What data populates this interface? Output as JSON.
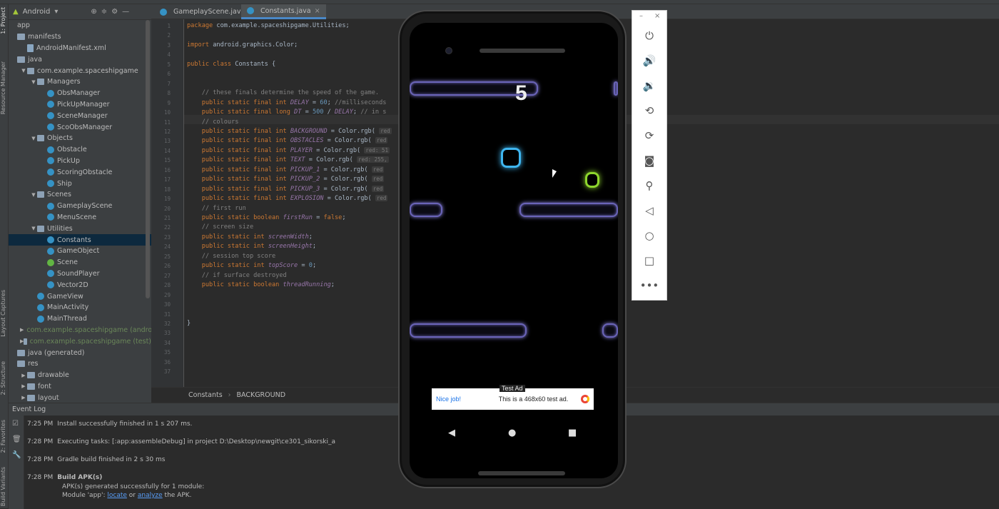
{
  "project_panel": {
    "view_selector": "Android",
    "tree": [
      {
        "label": "app",
        "depth": 0,
        "icon": "none",
        "arrow": ""
      },
      {
        "label": "manifests",
        "depth": 0,
        "icon": "folder",
        "arrow": ""
      },
      {
        "label": "AndroidManifest.xml",
        "depth": 1,
        "icon": "xml",
        "arrow": ""
      },
      {
        "label": "java",
        "depth": 0,
        "icon": "folder",
        "arrow": ""
      },
      {
        "label": "com.example.spaceshipgame",
        "depth": 1,
        "icon": "pkg",
        "arrow": "▼"
      },
      {
        "label": "Managers",
        "depth": 2,
        "icon": "pkg",
        "arrow": "▼"
      },
      {
        "label": "ObsManager",
        "depth": 3,
        "icon": "cls",
        "arrow": ""
      },
      {
        "label": "PickUpManager",
        "depth": 3,
        "icon": "cls",
        "arrow": ""
      },
      {
        "label": "SceneManager",
        "depth": 3,
        "icon": "cls",
        "arrow": ""
      },
      {
        "label": "ScoObsManager",
        "depth": 3,
        "icon": "cls",
        "arrow": ""
      },
      {
        "label": "Objects",
        "depth": 2,
        "icon": "pkg",
        "arrow": "▼"
      },
      {
        "label": "Obstacle",
        "depth": 3,
        "icon": "cls",
        "arrow": ""
      },
      {
        "label": "PickUp",
        "depth": 3,
        "icon": "cls",
        "arrow": ""
      },
      {
        "label": "ScoringObstacle",
        "depth": 3,
        "icon": "cls",
        "arrow": ""
      },
      {
        "label": "Ship",
        "depth": 3,
        "icon": "cls",
        "arrow": ""
      },
      {
        "label": "Scenes",
        "depth": 2,
        "icon": "pkg",
        "arrow": "▼"
      },
      {
        "label": "GameplayScene",
        "depth": 3,
        "icon": "cls",
        "arrow": ""
      },
      {
        "label": "MenuScene",
        "depth": 3,
        "icon": "cls",
        "arrow": ""
      },
      {
        "label": "Utilities",
        "depth": 2,
        "icon": "pkg",
        "arrow": "▼"
      },
      {
        "label": "Constants",
        "depth": 3,
        "icon": "cls",
        "arrow": "",
        "selected": true
      },
      {
        "label": "GameObject",
        "depth": 3,
        "icon": "cls",
        "arrow": ""
      },
      {
        "label": "Scene",
        "depth": 3,
        "icon": "intf",
        "arrow": ""
      },
      {
        "label": "SoundPlayer",
        "depth": 3,
        "icon": "cls",
        "arrow": ""
      },
      {
        "label": "Vector2D",
        "depth": 3,
        "icon": "cls",
        "arrow": ""
      },
      {
        "label": "GameView",
        "depth": 2,
        "icon": "cls",
        "arrow": ""
      },
      {
        "label": "MainActivity",
        "depth": 2,
        "icon": "cls",
        "arrow": ""
      },
      {
        "label": "MainThread",
        "depth": 2,
        "icon": "cls",
        "arrow": ""
      },
      {
        "label": "com.example.spaceshipgame (androidT",
        "depth": 1,
        "icon": "pkg",
        "arrow": "▶",
        "mod": true
      },
      {
        "label": "com.example.spaceshipgame (test)",
        "depth": 1,
        "icon": "pkg",
        "arrow": "▶",
        "mod": true
      },
      {
        "label": "java (generated)",
        "depth": 0,
        "icon": "folder",
        "arrow": ""
      },
      {
        "label": "res",
        "depth": 0,
        "icon": "folder",
        "arrow": ""
      },
      {
        "label": "drawable",
        "depth": 1,
        "icon": "folder",
        "arrow": "▶"
      },
      {
        "label": "font",
        "depth": 1,
        "icon": "folder",
        "arrow": "▶"
      },
      {
        "label": "layout",
        "depth": 1,
        "icon": "folder",
        "arrow": "▶"
      }
    ]
  },
  "side_tabs": {
    "project": "1: Project",
    "resource_manager": "Resource Manager",
    "layout_captures": "Layout Captures",
    "structure": "2: Structure",
    "favorites": "2: Favorites",
    "build_variants": "Build Variants"
  },
  "editor": {
    "tabs": [
      {
        "label": "GameplayScene.java",
        "active": false
      },
      {
        "label": "Constants.java",
        "active": true
      }
    ],
    "line_numbers": [
      "1",
      "2",
      "3",
      "4",
      "5",
      "6",
      "7",
      "8",
      "9",
      "10",
      "11",
      "12",
      "13",
      "14",
      "15",
      "16",
      "17",
      "18",
      "19",
      "20",
      "21",
      "22",
      "23",
      "24",
      "25",
      "26",
      "27",
      "28",
      "29",
      "30",
      "31",
      "32",
      "33",
      "34",
      "35",
      "36",
      "37"
    ],
    "lines": [
      {
        "n": 1,
        "parts": [
          [
            "kw",
            "package "
          ],
          [
            "",
            "com.example.spaceshipgame.Utilities;"
          ]
        ]
      },
      {
        "n": 3,
        "parts": [
          [
            "kw",
            "import "
          ],
          [
            "",
            "android.graphics.Color;"
          ]
        ]
      },
      {
        "n": 5,
        "parts": [
          [
            "kw",
            "public class "
          ],
          [
            "",
            "Constants {"
          ]
        ]
      },
      {
        "n": 8,
        "parts": [
          [
            "cm",
            "    // these finals determine the speed of the game."
          ]
        ]
      },
      {
        "n": 9,
        "parts": [
          [
            "kw",
            "    public static final int "
          ],
          [
            "fld",
            "DELAY"
          ],
          [
            "",
            " = "
          ],
          [
            "num",
            "60"
          ],
          [
            "",
            ";"
          ],
          [
            "cm",
            " //milliseconds"
          ]
        ]
      },
      {
        "n": 10,
        "parts": [
          [
            "kw",
            "    public static final long "
          ],
          [
            "fld",
            "DT"
          ],
          [
            "",
            " = "
          ],
          [
            "num",
            "500"
          ],
          [
            "",
            " / "
          ],
          [
            "fld",
            "DELAY"
          ],
          [
            "",
            ";"
          ],
          [
            "cm",
            " // in s"
          ]
        ]
      },
      {
        "n": 11,
        "parts": [
          [
            "cm",
            "    // colours"
          ]
        ]
      },
      {
        "n": 12,
        "parts": [
          [
            "kw",
            "    public static final int "
          ],
          [
            "fld",
            "BACKGROUND"
          ],
          [
            "",
            " = Color.rgb( "
          ],
          [
            "hint",
            "red"
          ]
        ]
      },
      {
        "n": 13,
        "parts": [
          [
            "kw",
            "    public static final int "
          ],
          [
            "fld",
            "OBSTACLES"
          ],
          [
            "",
            " = Color.rgb( "
          ],
          [
            "hint",
            "red"
          ]
        ]
      },
      {
        "n": 14,
        "parts": [
          [
            "kw",
            "    public static final int "
          ],
          [
            "fld",
            "PLAYER"
          ],
          [
            "",
            " = Color.rgb( "
          ],
          [
            "hint",
            "red: 51"
          ]
        ]
      },
      {
        "n": 15,
        "parts": [
          [
            "kw",
            "    public static final int "
          ],
          [
            "fld",
            "TEXT"
          ],
          [
            "",
            " = Color.rgb( "
          ],
          [
            "hint",
            "red: 255,"
          ]
        ]
      },
      {
        "n": 16,
        "parts": [
          [
            "kw",
            "    public static final int "
          ],
          [
            "fld",
            "PICKUP_1"
          ],
          [
            "",
            " = Color.rgb( "
          ],
          [
            "hint",
            "red"
          ]
        ]
      },
      {
        "n": 17,
        "parts": [
          [
            "kw",
            "    public static final int "
          ],
          [
            "fld",
            "PICKUP_2"
          ],
          [
            "",
            " = Color.rgb( "
          ],
          [
            "hint",
            "red"
          ]
        ]
      },
      {
        "n": 18,
        "parts": [
          [
            "kw",
            "    public static final int "
          ],
          [
            "fld",
            "PICKUP_3"
          ],
          [
            "",
            " = Color.rgb( "
          ],
          [
            "hint",
            "red"
          ]
        ]
      },
      {
        "n": 19,
        "parts": [
          [
            "kw",
            "    public static final int "
          ],
          [
            "fld",
            "EXPLOSION"
          ],
          [
            "",
            " = Color.rgb( "
          ],
          [
            "hint",
            "red"
          ]
        ]
      },
      {
        "n": 20,
        "parts": [
          [
            "cm",
            "    // first run"
          ]
        ]
      },
      {
        "n": 21,
        "parts": [
          [
            "kw",
            "    public static boolean "
          ],
          [
            "fld",
            "firstRun"
          ],
          [
            "",
            " = "
          ],
          [
            "kw",
            "false"
          ],
          [
            "",
            ";"
          ]
        ]
      },
      {
        "n": 22,
        "parts": [
          [
            "cm",
            "    // screen size"
          ]
        ]
      },
      {
        "n": 23,
        "parts": [
          [
            "kw",
            "    public static int "
          ],
          [
            "fld",
            "screenWidth"
          ],
          [
            "",
            ";"
          ]
        ]
      },
      {
        "n": 24,
        "parts": [
          [
            "kw",
            "    public static int "
          ],
          [
            "fld",
            "screenHeight"
          ],
          [
            "",
            ";"
          ]
        ]
      },
      {
        "n": 25,
        "parts": [
          [
            "cm",
            "    // session top score"
          ]
        ]
      },
      {
        "n": 26,
        "parts": [
          [
            "kw",
            "    public static int "
          ],
          [
            "fld",
            "topScore"
          ],
          [
            "",
            " = "
          ],
          [
            "num",
            "0"
          ],
          [
            "",
            ";"
          ]
        ]
      },
      {
        "n": 27,
        "parts": [
          [
            "cm",
            "    // if surface destroyed"
          ]
        ]
      },
      {
        "n": 28,
        "parts": [
          [
            "kw",
            "    public static boolean "
          ],
          [
            "fld",
            "threadRunning"
          ],
          [
            "",
            ";"
          ]
        ]
      },
      {
        "n": 32,
        "parts": [
          [
            "",
            "}"
          ]
        ]
      }
    ],
    "breadcrumb": [
      "Constants",
      "BACKGROUND"
    ]
  },
  "event_log": {
    "title": "Event Log",
    "entries": [
      {
        "time": "7:25 PM",
        "text": "Install successfully finished in 1 s 207 ms."
      },
      {
        "time": "7:28 PM",
        "text": "Executing tasks: [:app:assembleDebug] in project D:\\Desktop\\newgit\\ce301_sikorski_a"
      },
      {
        "time": "7:28 PM",
        "text": "Gradle build finished in 2 s 30 ms"
      }
    ],
    "last": {
      "time": "7:28 PM",
      "title": "Build APK(s)",
      "line1": "APK(s) generated successfully for 1 module:",
      "line2_pre": "Module 'app': ",
      "link1": "locate",
      "mid": " or ",
      "link2": "analyze",
      "post": " the APK."
    }
  },
  "emulator": {
    "score": "5",
    "ad": {
      "tag": "Test Ad",
      "left": "Nice job!",
      "center": "This is a 468x60 test ad."
    },
    "nav": {
      "back": "◀",
      "home": "●",
      "recents": "■"
    },
    "colors": {
      "obstacle": "#6a64b8",
      "player": "#3fb6f0",
      "pickup": "#8ed62d"
    }
  },
  "emulator_toolbar": {
    "window_controls": [
      "–",
      "×"
    ],
    "buttons": [
      {
        "name": "power-icon",
        "glyph": "⏻"
      },
      {
        "name": "volume-up-icon",
        "glyph": "🔊"
      },
      {
        "name": "volume-down-icon",
        "glyph": "🔉"
      },
      {
        "name": "rotate-left-icon",
        "glyph": "⟲"
      },
      {
        "name": "rotate-right-icon",
        "glyph": "⟳"
      },
      {
        "name": "camera-icon",
        "glyph": "◙"
      },
      {
        "name": "zoom-icon",
        "glyph": "⚲"
      },
      {
        "name": "back-icon",
        "glyph": "◁"
      },
      {
        "name": "home-icon",
        "glyph": "○"
      },
      {
        "name": "overview-icon",
        "glyph": "□"
      },
      {
        "name": "more-icon",
        "glyph": "•••"
      }
    ]
  }
}
